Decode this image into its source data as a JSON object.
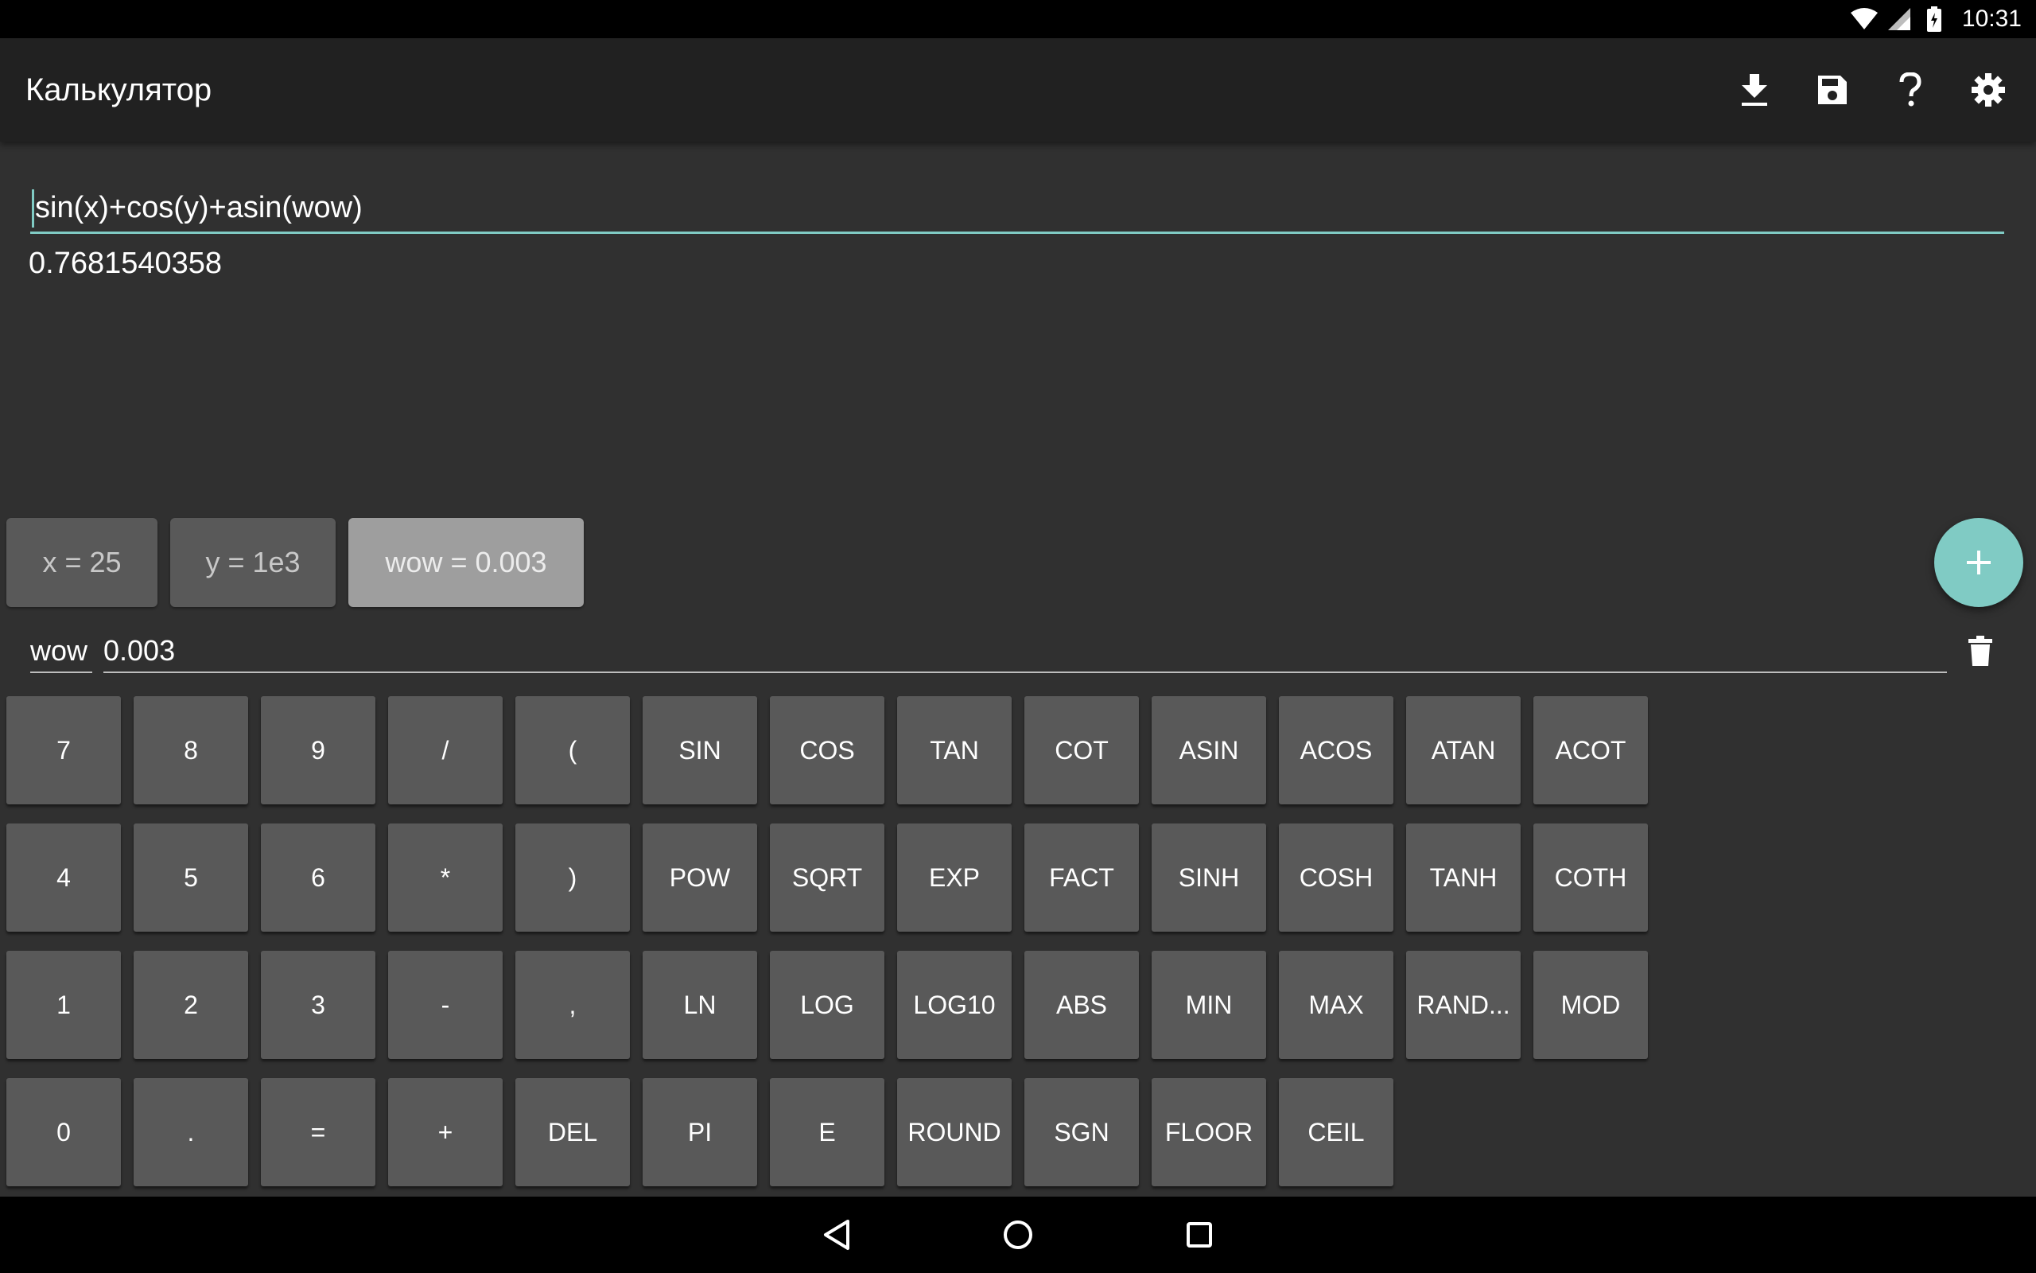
{
  "status_bar": {
    "time": "10:31",
    "icons": [
      "wifi-icon",
      "cell-signal-icon",
      "battery-icon"
    ]
  },
  "app_bar": {
    "title": "Калькулятор",
    "actions": [
      "download-icon",
      "save-icon",
      "help-icon",
      "settings-icon"
    ]
  },
  "expression": {
    "value": "sin(x)+cos(y)+asin(wow)",
    "result": "0.7681540358"
  },
  "variables": [
    {
      "label": "x = 25",
      "selected": false
    },
    {
      "label": "y = 1e3",
      "selected": false
    },
    {
      "label": "wow = 0.003",
      "selected": true
    }
  ],
  "fab_label": "+",
  "editor": {
    "name": "wow",
    "value": "0.003"
  },
  "keypad": [
    [
      "7",
      "8",
      "9",
      "/",
      "(",
      "SIN",
      "COS",
      "TAN",
      "COT",
      "ASIN",
      "ACOS",
      "ATAN",
      "ACOT"
    ],
    [
      "4",
      "5",
      "6",
      "*",
      ")",
      "POW",
      "SQRT",
      "EXP",
      "FACT",
      "SINH",
      "COSH",
      "TANH",
      "COTH"
    ],
    [
      "1",
      "2",
      "3",
      "-",
      ",",
      "LN",
      "LOG",
      "LOG10",
      "ABS",
      "MIN",
      "MAX",
      "RAND...",
      "MOD"
    ],
    [
      "0",
      ".",
      "=",
      "+",
      "DEL",
      "PI",
      "E",
      "ROUND",
      "SGN",
      "FLOOR",
      "CEIL"
    ]
  ],
  "colors": {
    "accent": "#80cbc4",
    "background": "#303030",
    "app_bar": "#212121",
    "key": "#595959",
    "chip_selected": "#9e9e9e"
  }
}
